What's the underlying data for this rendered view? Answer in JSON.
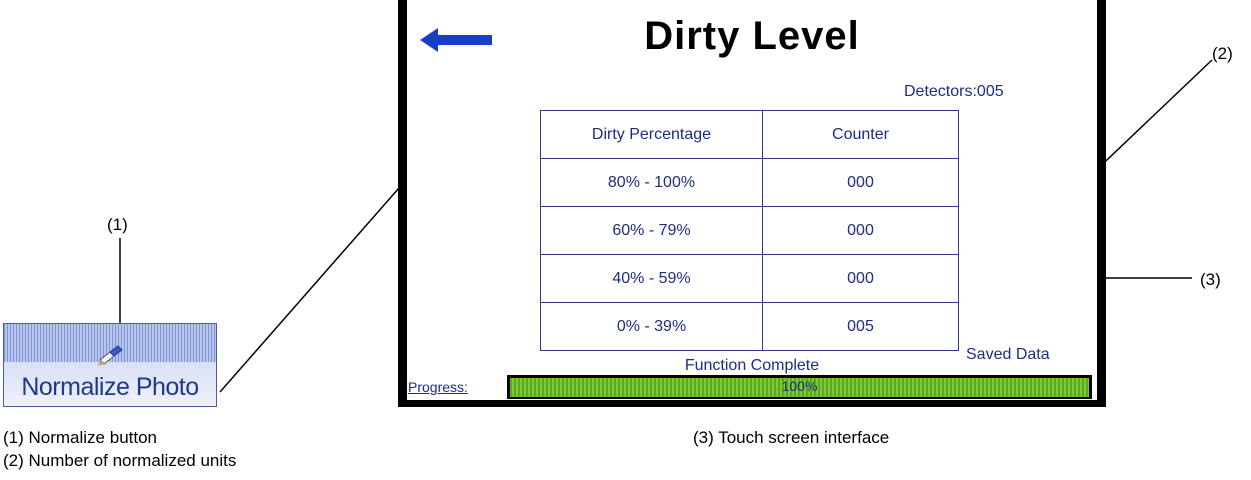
{
  "callouts": {
    "c1": "(1)",
    "c2": "(2)",
    "c3": "(3)"
  },
  "normalize_button": {
    "label": "Normalize Photo",
    "icon": "brush-icon"
  },
  "screen": {
    "title": "Dirty Level",
    "detectors": "Detectors:005",
    "table": {
      "headers": [
        "Dirty Percentage",
        "Counter"
      ],
      "rows": [
        [
          "80% - 100%",
          "000"
        ],
        [
          "60% - 79%",
          "000"
        ],
        [
          "40% - 59%",
          "000"
        ],
        [
          "0% - 39%",
          "005"
        ]
      ]
    },
    "saved_data": "Saved Data",
    "status": "Function Complete",
    "progress_label": "Progress:",
    "progress_text": "100%",
    "progress_value": 1.0
  },
  "legend": [
    "(1)  Normalize button",
    "(2)  Number of normalized units",
    "(3)  Touch screen interface"
  ]
}
